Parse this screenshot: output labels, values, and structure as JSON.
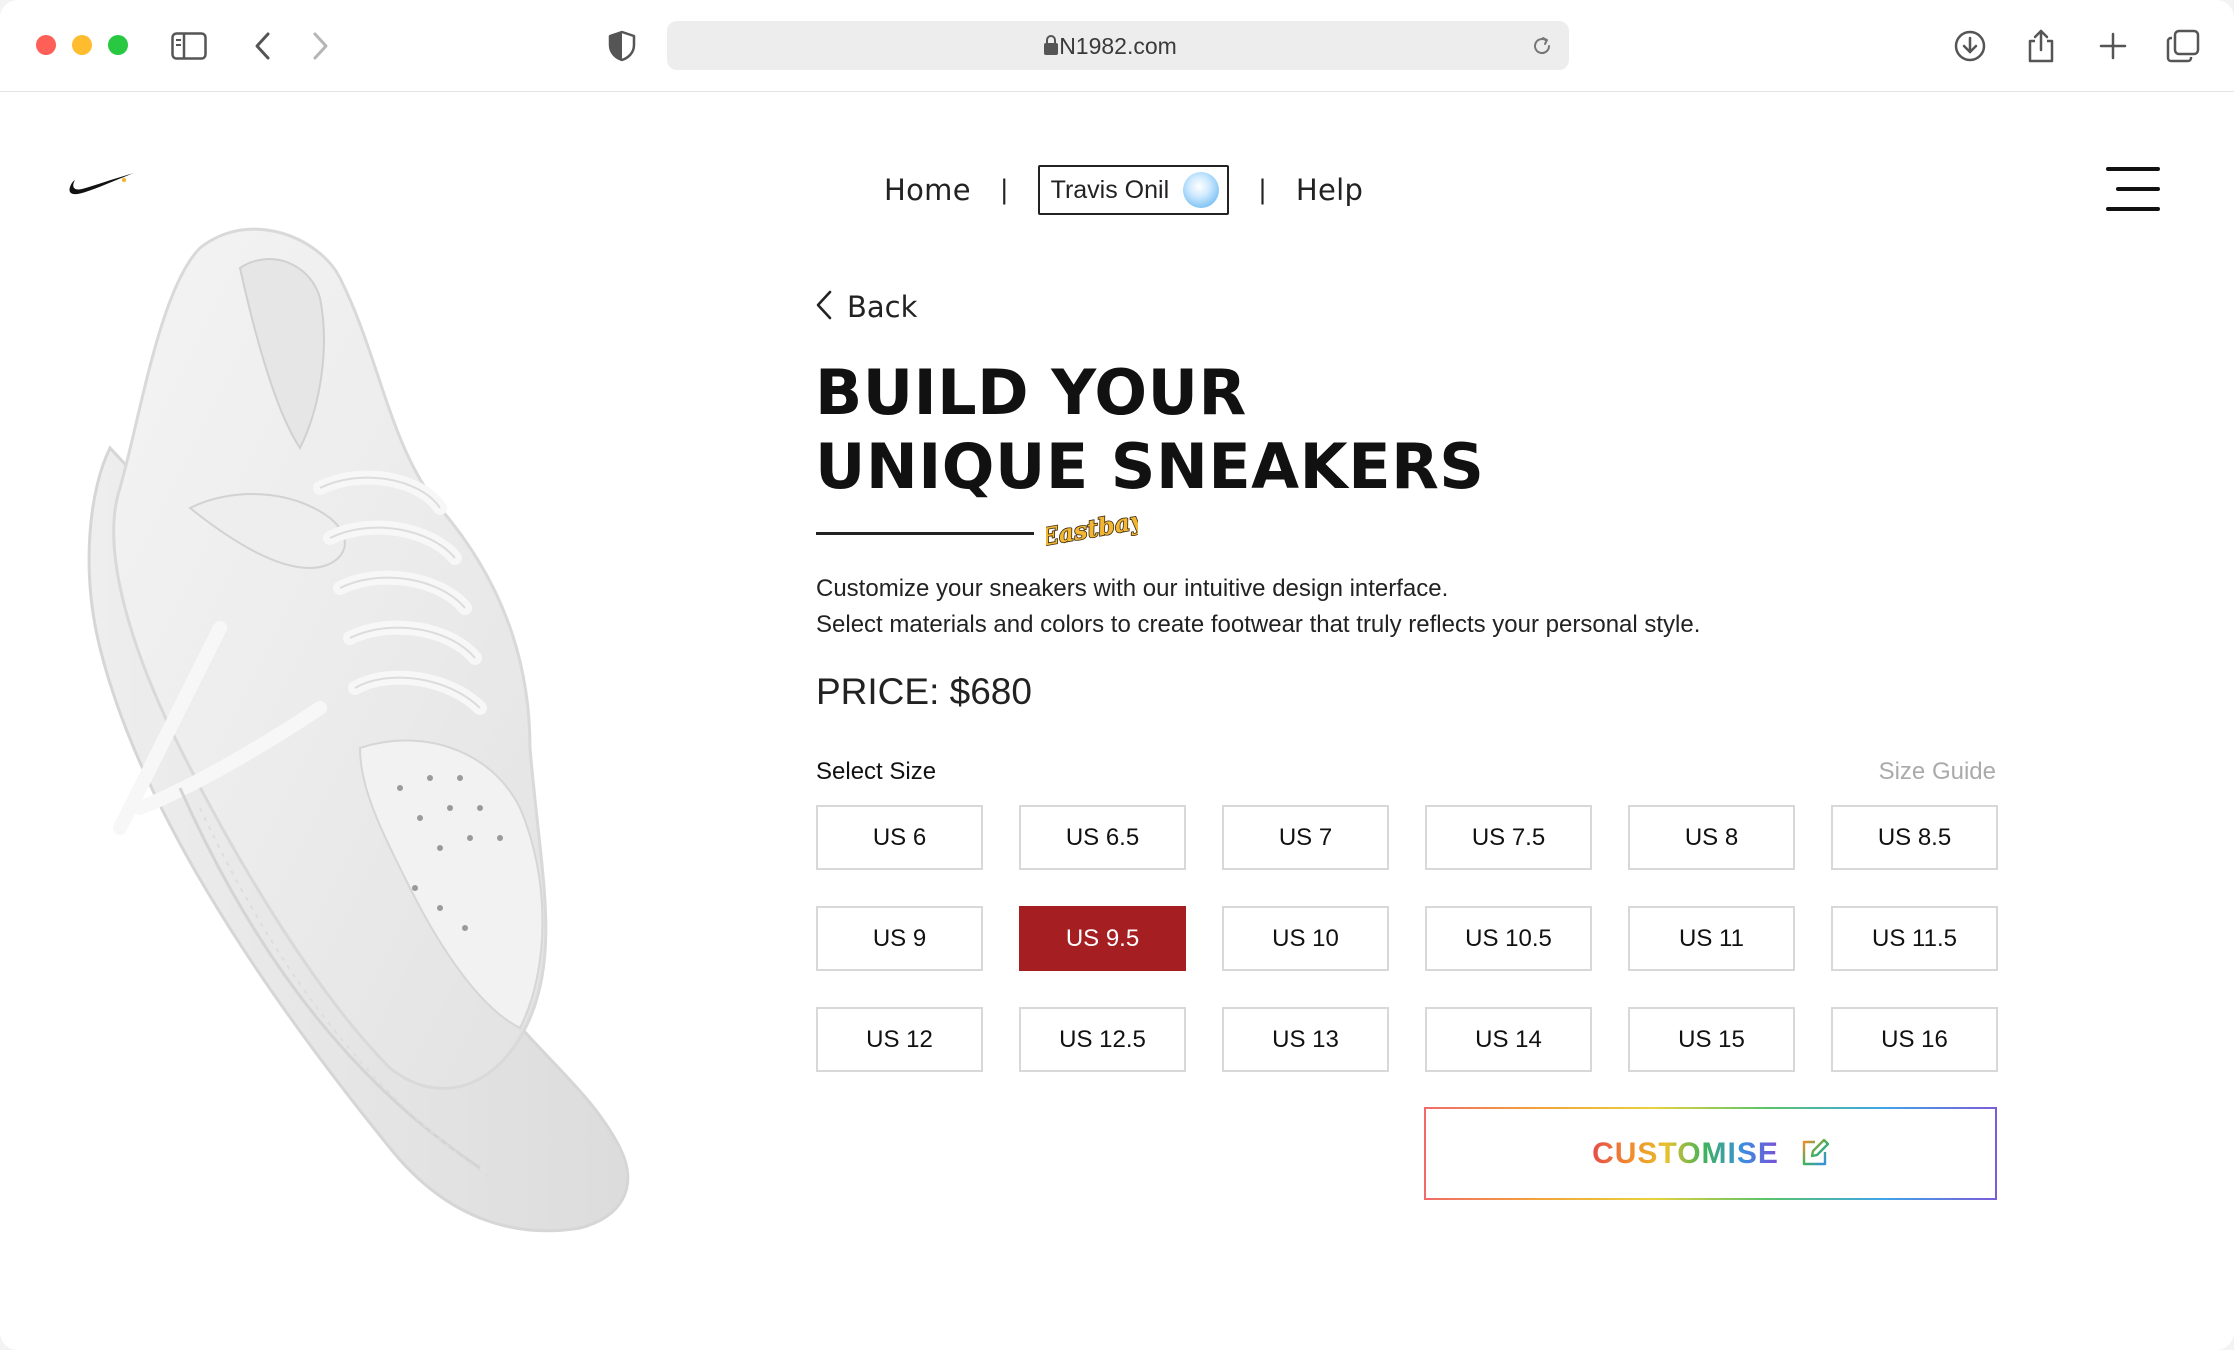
{
  "browser": {
    "url": "N1982.com",
    "icons": {
      "sidebar": "sidebar-icon",
      "back": "chevron-left-icon",
      "forward": "chevron-right-icon",
      "privacy": "shield-icon",
      "lock": "lock-icon",
      "reload": "reload-icon",
      "download": "download-icon",
      "share": "share-icon",
      "new_tab": "plus-icon",
      "tabs": "tabs-overview-icon"
    }
  },
  "header": {
    "nav": {
      "home": "Home",
      "user_name": "Travis Onil",
      "help": "Help",
      "separator": "|"
    }
  },
  "main": {
    "back_label": "Back",
    "headline_line1": "BUILD YOUR",
    "headline_line2": "UNIQUE SNEAKERS",
    "badge_text": "Eastbay",
    "description_line1": "Customize your sneakers with our intuitive design interface.",
    "description_line2": "Select materials and colors to create footwear that truly reflects your personal style.",
    "price": "PRICE: $680",
    "select_size_label": "Select Size",
    "size_guide_label": "Size Guide",
    "sizes": [
      {
        "label": "US 6"
      },
      {
        "label": "US 6.5"
      },
      {
        "label": "US 7"
      },
      {
        "label": "US 7.5"
      },
      {
        "label": "US 8"
      },
      {
        "label": "US 8.5"
      },
      {
        "label": "US 9"
      },
      {
        "label": "US 9.5"
      },
      {
        "label": "US 10"
      },
      {
        "label": "US 10.5"
      },
      {
        "label": "US 11"
      },
      {
        "label": "US 11.5"
      },
      {
        "label": "US 12"
      },
      {
        "label": "US 12.5"
      },
      {
        "label": "US 13"
      },
      {
        "label": "US 14"
      },
      {
        "label": "US 15"
      },
      {
        "label": "US 16"
      }
    ],
    "selected_size": "US 9.5",
    "customise_label": "CUSTOMISE"
  },
  "colors": {
    "selected_size": "#a51e22",
    "badge": "#f2b632"
  }
}
